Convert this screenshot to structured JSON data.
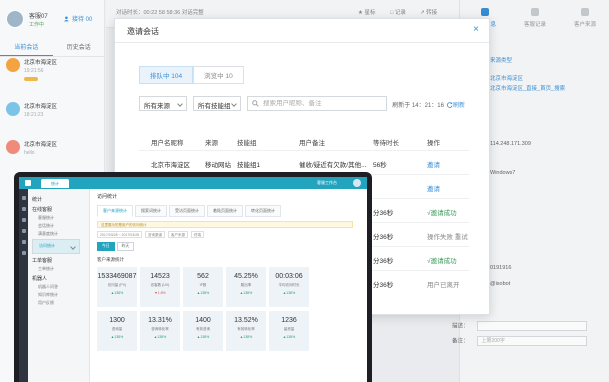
{
  "left_panel": {
    "user": {
      "name": "客服07",
      "status": "工作中"
    },
    "add_label": "接待 00",
    "tabs": [
      "当前会话",
      "历史会话"
    ],
    "conversations": [
      {
        "name": "北京市海淀区",
        "sub": "19:21:56"
      },
      {
        "name": "北京市海淀区",
        "sub": "18:21:23"
      },
      {
        "name": "北京市海淀区",
        "sub": "hello"
      }
    ]
  },
  "top_bar": {
    "info": "对话时长：00:22   58 58:36   对话完整",
    "actions": [
      "★ 星标",
      "□ 记录",
      "↗ 转接"
    ]
  },
  "right_panel": {
    "tabs": [
      "客户信息",
      "客服记录",
      "客户来源"
    ],
    "lines": [
      "来源类型",
      "北京市海淀区",
      "北京市海淀区_直接_首页_搜索",
      "114.248.171.309",
      "Windows7",
      "0191916",
      "@isobot"
    ],
    "remark_label": "描述：",
    "note_label": "备注：",
    "note_placeholder": "上限200字"
  },
  "modal": {
    "title": "邀请会话",
    "close": "×",
    "tabs": [
      "排队中 104",
      "浏览中 10"
    ],
    "filters": {
      "source": "所有来源",
      "skill_group": "所有技能组",
      "search_placeholder": "搜索用户昵称、备注"
    },
    "refresh": {
      "time": "刷新于 14：21：16",
      "label": "刷新"
    },
    "columns": [
      "用户名昵称",
      "来源",
      "技能组",
      "用户备注",
      "等待时长",
      "操作"
    ],
    "rows": [
      {
        "name": "北京市海淀区",
        "source": "移动网站",
        "group": "技能组1",
        "note": "催收/疑近有欠款/其他...",
        "wait": "56秒",
        "action": "邀请",
        "action_type": "link"
      },
      {
        "name": "",
        "source": "",
        "group": "",
        "note": "",
        "wait": "",
        "action": "邀请",
        "action_type": "link"
      },
      {
        "name": "",
        "source": "",
        "group": "",
        "note": "",
        "wait": "分36秒",
        "action": "√邀请成功",
        "action_type": "ok"
      },
      {
        "name": "",
        "source": "",
        "group": "",
        "note": "",
        "wait": "分36秒",
        "action": "操作失败 重试",
        "action_type": "retry"
      },
      {
        "name": "",
        "source": "",
        "group": "",
        "note": "",
        "wait": "分36秒",
        "action": "√邀请成功",
        "action_type": "ok"
      },
      {
        "name": "",
        "source": "",
        "group": "",
        "note": "",
        "wait": "分36秒",
        "action": "用户已离开",
        "action_type": "muted"
      }
    ]
  },
  "laptop": {
    "tab": "统计",
    "top_right": "客服工作台",
    "nav": {
      "title": "统计",
      "groups": [
        {
          "heading": "在线客服",
          "items": [
            "客服统计",
            "会话统计",
            "满意度统计",
            "访问统计"
          ]
        },
        {
          "heading": "工单客服",
          "items": [
            "工单统计"
          ]
        },
        {
          "heading": "机器人",
          "items": [
            "机器人问答",
            "知识库统计",
            "用户反馈"
          ]
        }
      ],
      "selected": "访问统计"
    },
    "crumb": "访问统计",
    "tabs": [
      "客户来源统计",
      "搜索词统计",
      "受访页面统计",
      "着陆页面统计",
      "转化页面统计"
    ],
    "notice": "这里展示的是用户的访问统计",
    "filters": [
      "2017/03/28 ~ 2017/03/28",
      "咨询渠道",
      "客户来源",
      "终端"
    ],
    "buttons": [
      "今日",
      "昨天"
    ],
    "section": "客户来源统计",
    "cards": [
      {
        "value": "1533469087",
        "label": "访问量 (PV)",
        "delta": "▲138%",
        "dir": "up"
      },
      {
        "value": "14523",
        "label": "访客数 (UV)",
        "delta": "▼1.8%",
        "dir": "down"
      },
      {
        "value": "562",
        "label": "IP数",
        "delta": "▲138%",
        "dir": "up"
      },
      {
        "value": "45.25%",
        "label": "跳出率",
        "delta": "▲138%",
        "dir": "up"
      },
      {
        "value": "00:03:06",
        "label": "平均访问时长",
        "delta": "▲138%",
        "dir": "up"
      },
      {
        "value": "1300",
        "label": "咨询量",
        "delta": "▲138%",
        "dir": "up"
      },
      {
        "value": "13.31%",
        "label": "咨询转化率",
        "delta": "▲138%",
        "dir": "up"
      },
      {
        "value": "1400",
        "label": "有效咨询",
        "delta": "▲138%",
        "dir": "up"
      },
      {
        "value": "13.52%",
        "label": "有效转化率",
        "delta": "▲138%",
        "dir": "up"
      },
      {
        "value": "1236",
        "label": "留资量",
        "delta": "▲138%",
        "dir": "up"
      }
    ]
  }
}
